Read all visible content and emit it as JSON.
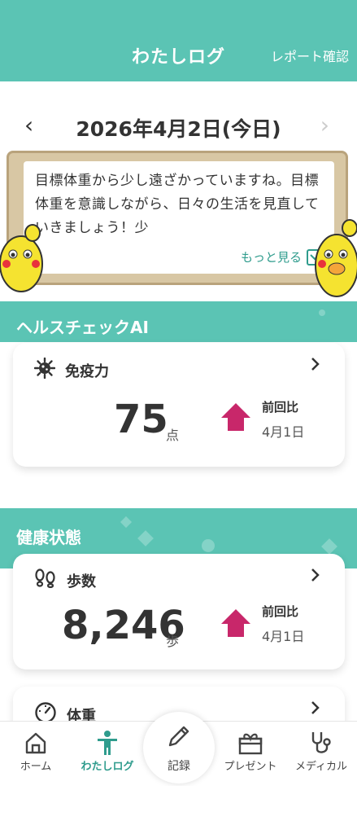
{
  "header": {
    "title": "わたしログ",
    "report_link": "レポート確認"
  },
  "date_nav": {
    "prev": "‹",
    "date": "2026年4月2日(今日)",
    "next": "›"
  },
  "message": {
    "text": "目標体重から少し遠ざかっていますね。目標体重を意識しながら、日々の生活を見直していきましょう！少",
    "more_label": "もっと見る"
  },
  "health_check": {
    "section_title": "ヘルスチェックAI",
    "card": {
      "title": "免疫力",
      "value": "75",
      "unit": "点",
      "compare_label": "前回比",
      "compare_date": "4月1日",
      "trend": "up"
    }
  },
  "health_status": {
    "section_title": "健康状態",
    "steps_card": {
      "title": "歩数",
      "value": "8,246",
      "unit": "歩",
      "compare_label": "前回比",
      "compare_date": "4月1日",
      "trend": "up"
    },
    "weight_card": {
      "title": "体重"
    }
  },
  "nav": {
    "home": "ホーム",
    "log": "わたしログ",
    "record": "記録",
    "present": "プレゼント",
    "medical": "メディカル"
  },
  "colors": {
    "primary": "#5bc4b4",
    "accent_up": "#c8276a",
    "link": "#2f9c8d"
  }
}
